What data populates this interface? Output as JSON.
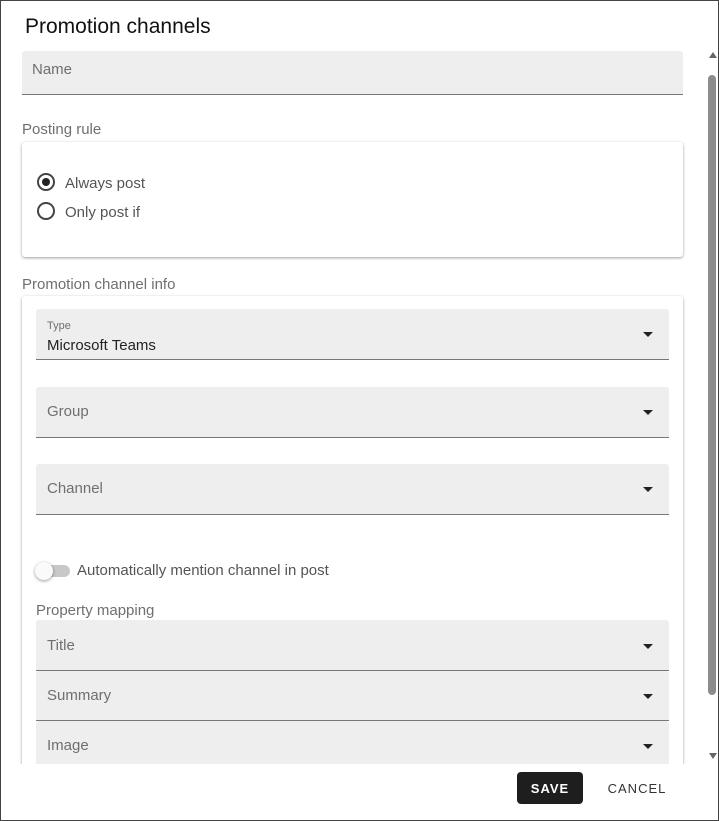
{
  "dialog": {
    "title": "Promotion channels",
    "save_label": "SAVE",
    "cancel_label": "CANCEL"
  },
  "name_field": {
    "label": "Name",
    "value": ""
  },
  "posting_rule": {
    "label": "Posting rule",
    "options": [
      {
        "label": "Always post",
        "selected": true
      },
      {
        "label": "Only post if",
        "selected": false
      }
    ]
  },
  "channel_info": {
    "label": "Promotion channel info",
    "type_field": {
      "label": "Type",
      "value": "Microsoft Teams"
    },
    "group_field": {
      "label": "Group"
    },
    "channel_field": {
      "label": "Channel"
    },
    "mention_toggle": {
      "label": "Automatically mention channel in post",
      "on": false
    },
    "property_mapping": {
      "label": "Property mapping",
      "fields": [
        {
          "label": "Title"
        },
        {
          "label": "Summary"
        },
        {
          "label": "Image"
        }
      ]
    }
  }
}
